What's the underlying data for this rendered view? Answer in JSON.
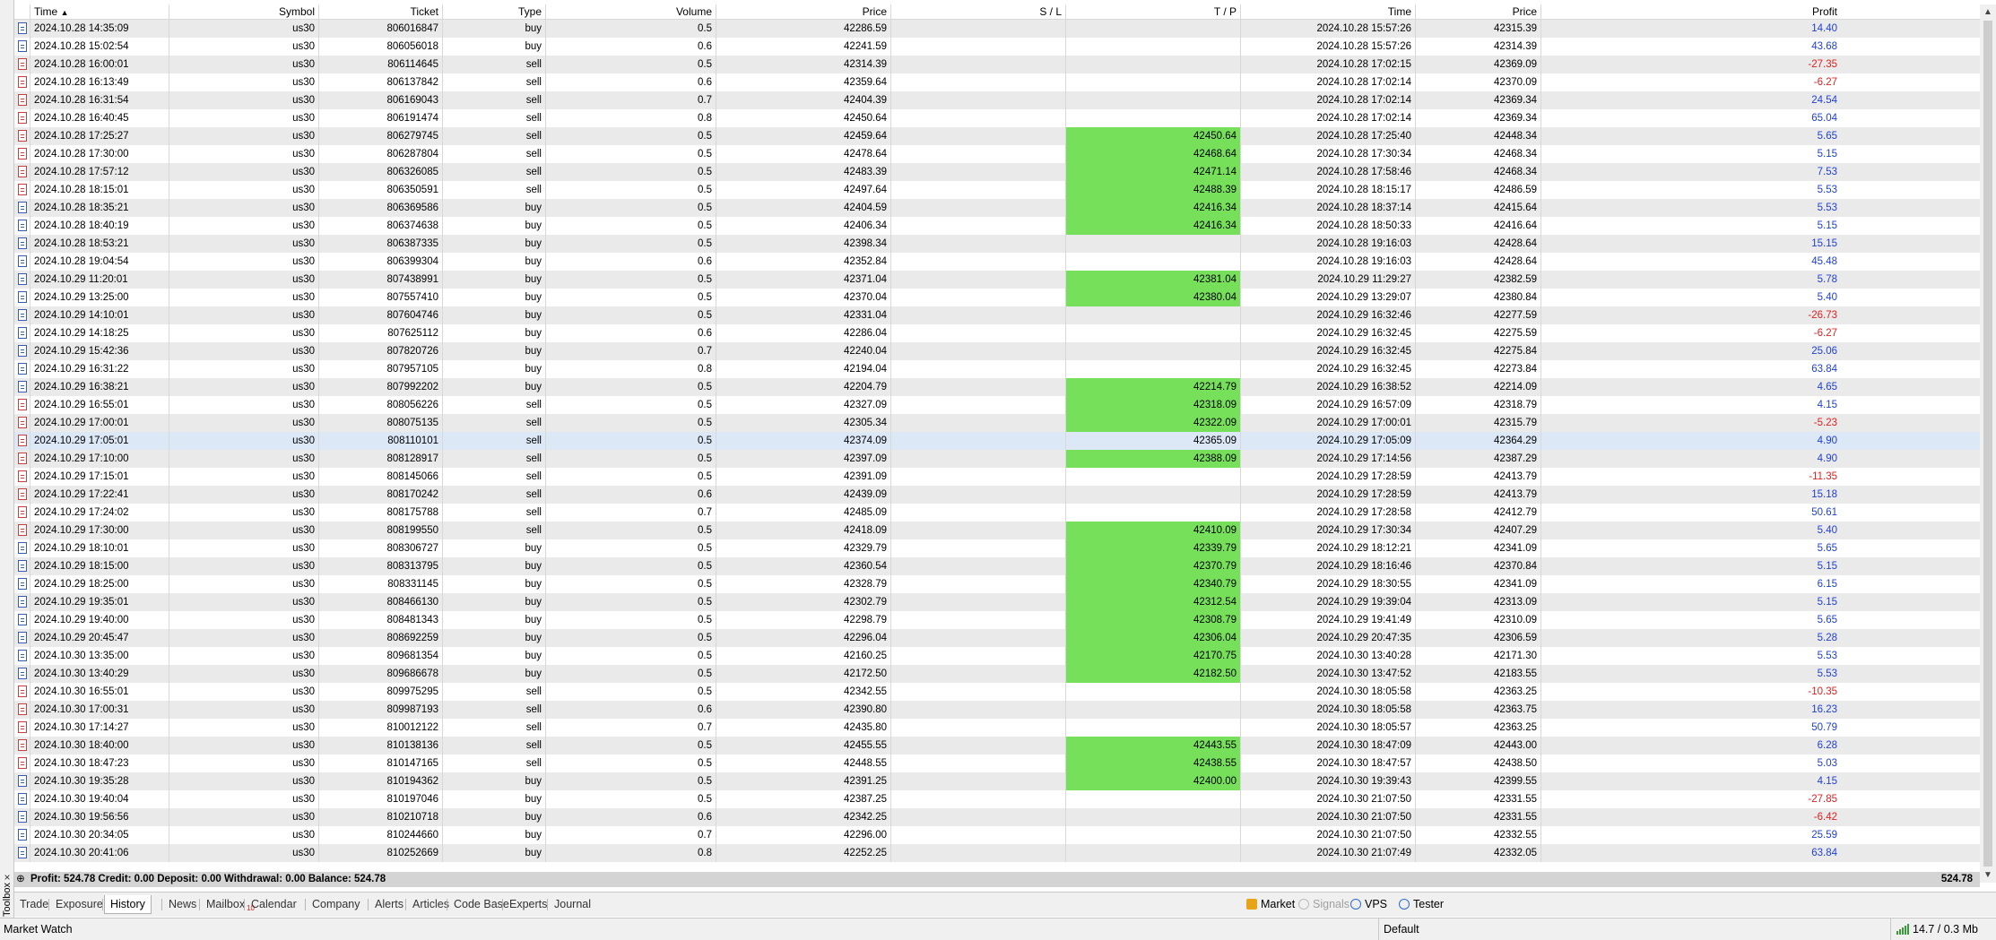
{
  "columns": [
    "",
    "Time",
    "Symbol",
    "Ticket",
    "Type",
    "Volume",
    "Price",
    "S / L",
    "T / P",
    "Time",
    "Price",
    "Profit"
  ],
  "sort_indicator": "▲",
  "rows": [
    [
      "2024.10.28 14:35:09",
      "us30",
      "806016847",
      "buy",
      "0.5",
      "42286.59",
      "",
      "",
      "2024.10.28 15:57:26",
      "42315.39",
      "14.40"
    ],
    [
      "2024.10.28 15:02:54",
      "us30",
      "806056018",
      "buy",
      "0.6",
      "42241.59",
      "",
      "",
      "2024.10.28 15:57:26",
      "42314.39",
      "43.68"
    ],
    [
      "2024.10.28 16:00:01",
      "us30",
      "806114645",
      "sell",
      "0.5",
      "42314.39",
      "",
      "",
      "2024.10.28 17:02:15",
      "42369.09",
      "-27.35"
    ],
    [
      "2024.10.28 16:13:49",
      "us30",
      "806137842",
      "sell",
      "0.6",
      "42359.64",
      "",
      "",
      "2024.10.28 17:02:14",
      "42370.09",
      "-6.27"
    ],
    [
      "2024.10.28 16:31:54",
      "us30",
      "806169043",
      "sell",
      "0.7",
      "42404.39",
      "",
      "",
      "2024.10.28 17:02:14",
      "42369.34",
      "24.54"
    ],
    [
      "2024.10.28 16:40:45",
      "us30",
      "806191474",
      "sell",
      "0.8",
      "42450.64",
      "",
      "",
      "2024.10.28 17:02:14",
      "42369.34",
      "65.04"
    ],
    [
      "2024.10.28 17:25:27",
      "us30",
      "806279745",
      "sell",
      "0.5",
      "42459.64",
      "",
      "42450.64",
      "2024.10.28 17:25:40",
      "42448.34",
      "5.65"
    ],
    [
      "2024.10.28 17:30:00",
      "us30",
      "806287804",
      "sell",
      "0.5",
      "42478.64",
      "",
      "42468.64",
      "2024.10.28 17:30:34",
      "42468.34",
      "5.15"
    ],
    [
      "2024.10.28 17:57:12",
      "us30",
      "806326085",
      "sell",
      "0.5",
      "42483.39",
      "",
      "42471.14",
      "2024.10.28 17:58:46",
      "42468.34",
      "7.53"
    ],
    [
      "2024.10.28 18:15:01",
      "us30",
      "806350591",
      "sell",
      "0.5",
      "42497.64",
      "",
      "42488.39",
      "2024.10.28 18:15:17",
      "42486.59",
      "5.53"
    ],
    [
      "2024.10.28 18:35:21",
      "us30",
      "806369586",
      "buy",
      "0.5",
      "42404.59",
      "",
      "42416.34",
      "2024.10.28 18:37:14",
      "42415.64",
      "5.53"
    ],
    [
      "2024.10.28 18:40:19",
      "us30",
      "806374638",
      "buy",
      "0.5",
      "42406.34",
      "",
      "42416.34",
      "2024.10.28 18:50:33",
      "42416.64",
      "5.15"
    ],
    [
      "2024.10.28 18:53:21",
      "us30",
      "806387335",
      "buy",
      "0.5",
      "42398.34",
      "",
      "",
      "2024.10.28 19:16:03",
      "42428.64",
      "15.15"
    ],
    [
      "2024.10.28 19:04:54",
      "us30",
      "806399304",
      "buy",
      "0.6",
      "42352.84",
      "",
      "",
      "2024.10.28 19:16:03",
      "42428.64",
      "45.48"
    ],
    [
      "2024.10.29 11:20:01",
      "us30",
      "807438991",
      "buy",
      "0.5",
      "42371.04",
      "",
      "42381.04",
      "2024.10.29 11:29:27",
      "42382.59",
      "5.78"
    ],
    [
      "2024.10.29 13:25:00",
      "us30",
      "807557410",
      "buy",
      "0.5",
      "42370.04",
      "",
      "42380.04",
      "2024.10.29 13:29:07",
      "42380.84",
      "5.40"
    ],
    [
      "2024.10.29 14:10:01",
      "us30",
      "807604746",
      "buy",
      "0.5",
      "42331.04",
      "",
      "",
      "2024.10.29 16:32:46",
      "42277.59",
      "-26.73"
    ],
    [
      "2024.10.29 14:18:25",
      "us30",
      "807625112",
      "buy",
      "0.6",
      "42286.04",
      "",
      "",
      "2024.10.29 16:32:45",
      "42275.59",
      "-6.27"
    ],
    [
      "2024.10.29 15:42:36",
      "us30",
      "807820726",
      "buy",
      "0.7",
      "42240.04",
      "",
      "",
      "2024.10.29 16:32:45",
      "42275.84",
      "25.06"
    ],
    [
      "2024.10.29 16:31:22",
      "us30",
      "807957105",
      "buy",
      "0.8",
      "42194.04",
      "",
      "",
      "2024.10.29 16:32:45",
      "42273.84",
      "63.84"
    ],
    [
      "2024.10.29 16:38:21",
      "us30",
      "807992202",
      "buy",
      "0.5",
      "42204.79",
      "",
      "42214.79",
      "2024.10.29 16:38:52",
      "42214.09",
      "4.65"
    ],
    [
      "2024.10.29 16:55:01",
      "us30",
      "808056226",
      "sell",
      "0.5",
      "42327.09",
      "",
      "42318.09",
      "2024.10.29 16:57:09",
      "42318.79",
      "4.15"
    ],
    [
      "2024.10.29 17:00:01",
      "us30",
      "808075135",
      "sell",
      "0.5",
      "42305.34",
      "",
      "42322.09",
      "2024.10.29 17:00:01",
      "42315.79",
      "-5.23"
    ],
    [
      "2024.10.29 17:05:01",
      "us30",
      "808110101",
      "sell",
      "0.5",
      "42374.09",
      "",
      "42365.09",
      "2024.10.29 17:05:09",
      "42364.29",
      "4.90"
    ],
    [
      "2024.10.29 17:10:00",
      "us30",
      "808128917",
      "sell",
      "0.5",
      "42397.09",
      "",
      "42388.09",
      "2024.10.29 17:14:56",
      "42387.29",
      "4.90"
    ],
    [
      "2024.10.29 17:15:01",
      "us30",
      "808145066",
      "sell",
      "0.5",
      "42391.09",
      "",
      "",
      "2024.10.29 17:28:59",
      "42413.79",
      "-11.35"
    ],
    [
      "2024.10.29 17:22:41",
      "us30",
      "808170242",
      "sell",
      "0.6",
      "42439.09",
      "",
      "",
      "2024.10.29 17:28:59",
      "42413.79",
      "15.18"
    ],
    [
      "2024.10.29 17:24:02",
      "us30",
      "808175788",
      "sell",
      "0.7",
      "42485.09",
      "",
      "",
      "2024.10.29 17:28:58",
      "42412.79",
      "50.61"
    ],
    [
      "2024.10.29 17:30:00",
      "us30",
      "808199550",
      "sell",
      "0.5",
      "42418.09",
      "",
      "42410.09",
      "2024.10.29 17:30:34",
      "42407.29",
      "5.40"
    ],
    [
      "2024.10.29 18:10:01",
      "us30",
      "808306727",
      "buy",
      "0.5",
      "42329.79",
      "",
      "42339.79",
      "2024.10.29 18:12:21",
      "42341.09",
      "5.65"
    ],
    [
      "2024.10.29 18:15:00",
      "us30",
      "808313795",
      "buy",
      "0.5",
      "42360.54",
      "",
      "42370.79",
      "2024.10.29 18:16:46",
      "42370.84",
      "5.15"
    ],
    [
      "2024.10.29 18:25:00",
      "us30",
      "808331145",
      "buy",
      "0.5",
      "42328.79",
      "",
      "42340.79",
      "2024.10.29 18:30:55",
      "42341.09",
      "6.15"
    ],
    [
      "2024.10.29 19:35:01",
      "us30",
      "808466130",
      "buy",
      "0.5",
      "42302.79",
      "",
      "42312.54",
      "2024.10.29 19:39:04",
      "42313.09",
      "5.15"
    ],
    [
      "2024.10.29 19:40:00",
      "us30",
      "808481343",
      "buy",
      "0.5",
      "42298.79",
      "",
      "42308.79",
      "2024.10.29 19:41:49",
      "42310.09",
      "5.65"
    ],
    [
      "2024.10.29 20:45:47",
      "us30",
      "808692259",
      "buy",
      "0.5",
      "42296.04",
      "",
      "42306.04",
      "2024.10.29 20:47:35",
      "42306.59",
      "5.28"
    ],
    [
      "2024.10.30 13:35:00",
      "us30",
      "809681354",
      "buy",
      "0.5",
      "42160.25",
      "",
      "42170.75",
      "2024.10.30 13:40:28",
      "42171.30",
      "5.53"
    ],
    [
      "2024.10.30 13:40:29",
      "us30",
      "809686678",
      "buy",
      "0.5",
      "42172.50",
      "",
      "42182.50",
      "2024.10.30 13:47:52",
      "42183.55",
      "5.53"
    ],
    [
      "2024.10.30 16:55:01",
      "us30",
      "809975295",
      "sell",
      "0.5",
      "42342.55",
      "",
      "",
      "2024.10.30 18:05:58",
      "42363.25",
      "-10.35"
    ],
    [
      "2024.10.30 17:00:31",
      "us30",
      "809987193",
      "sell",
      "0.6",
      "42390.80",
      "",
      "",
      "2024.10.30 18:05:58",
      "42363.75",
      "16.23"
    ],
    [
      "2024.10.30 17:14:27",
      "us30",
      "810012122",
      "sell",
      "0.7",
      "42435.80",
      "",
      "",
      "2024.10.30 18:05:57",
      "42363.25",
      "50.79"
    ],
    [
      "2024.10.30 18:40:00",
      "us30",
      "810138136",
      "sell",
      "0.5",
      "42455.55",
      "",
      "42443.55",
      "2024.10.30 18:47:09",
      "42443.00",
      "6.28"
    ],
    [
      "2024.10.30 18:47:23",
      "us30",
      "810147165",
      "sell",
      "0.5",
      "42448.55",
      "",
      "42438.55",
      "2024.10.30 18:47:57",
      "42438.50",
      "5.03"
    ],
    [
      "2024.10.30 19:35:28",
      "us30",
      "810194362",
      "buy",
      "0.5",
      "42391.25",
      "",
      "42400.00",
      "2024.10.30 19:39:43",
      "42399.55",
      "4.15"
    ],
    [
      "2024.10.30 19:40:04",
      "us30",
      "810197046",
      "buy",
      "0.5",
      "42387.25",
      "",
      "",
      "2024.10.30 21:07:50",
      "42331.55",
      "-27.85"
    ],
    [
      "2024.10.30 19:56:56",
      "us30",
      "810210718",
      "buy",
      "0.6",
      "42342.25",
      "",
      "",
      "2024.10.30 21:07:50",
      "42331.55",
      "-6.42"
    ],
    [
      "2024.10.30 20:34:05",
      "us30",
      "810244660",
      "buy",
      "0.7",
      "42296.00",
      "",
      "",
      "2024.10.30 21:07:50",
      "42332.55",
      "25.59"
    ],
    [
      "2024.10.30 20:41:06",
      "us30",
      "810252669",
      "buy",
      "0.8",
      "42252.25",
      "",
      "",
      "2024.10.30 21:07:49",
      "42332.05",
      "63.84"
    ]
  ],
  "highlighted_tp": [
    6,
    7,
    8,
    9,
    10,
    11,
    14,
    15,
    20,
    21,
    22,
    24,
    28,
    29,
    30,
    31,
    32,
    33,
    34,
    35,
    36,
    40,
    41,
    42
  ],
  "selected_row": 23,
  "summary": {
    "plus": "⊕",
    "text": "Profit: 524.78  Credit: 0.00  Deposit: 0.00  Withdrawal: 0.00  Balance: 524.78",
    "total": "524.78"
  },
  "toolbox": {
    "label": "Toolbox",
    "close": "×"
  },
  "tabs": [
    {
      "label": "Trade"
    },
    {
      "label": "Exposure"
    },
    {
      "label": "History"
    },
    {
      "label": "News"
    },
    {
      "label": "Mailbox",
      "badge": "10"
    },
    {
      "label": "Calendar"
    },
    {
      "label": "Company"
    },
    {
      "label": "Alerts"
    },
    {
      "label": "Articles"
    },
    {
      "label": "Code Base"
    },
    {
      "label": "Experts"
    },
    {
      "label": "Journal"
    }
  ],
  "active_tab": "History",
  "right_tabs": [
    {
      "label": "Market",
      "icon": "market-bag-icon"
    },
    {
      "label": "Signals",
      "icon": "signals-icon"
    },
    {
      "label": "VPS",
      "icon": "vps-cloud-icon"
    },
    {
      "label": "Tester",
      "icon": "tester-icon"
    }
  ],
  "status": {
    "left": "Market Watch",
    "profile": "Default",
    "connection": "14.7 / 0.3 Mb"
  },
  "colors": {
    "tp_highlight": "#77e05a",
    "profit_positive": "#1f3fd6",
    "profit_negative": "#e02020",
    "alt_row": "#eaeaea",
    "selected_row": "#dce8f6"
  }
}
